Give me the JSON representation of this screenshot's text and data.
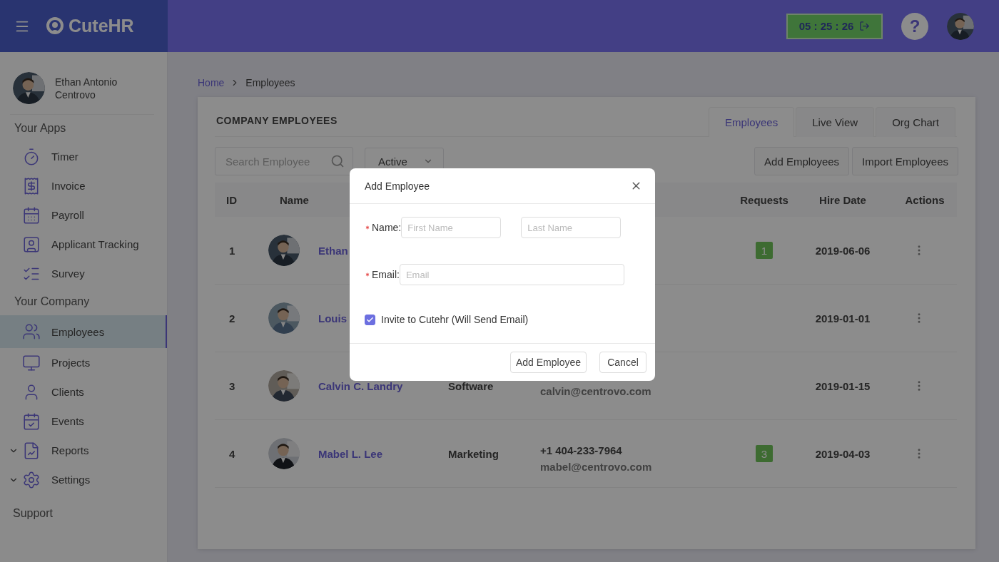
{
  "header": {
    "logo": "CuteHR",
    "timer": "05 : 25 : 26",
    "help_button": "?"
  },
  "sidebar": {
    "user_name": "Ethan Antonio Centrovo",
    "sections": [
      {
        "title": "Your Apps",
        "items": [
          {
            "label": "Timer",
            "selected": false,
            "expandable": false
          },
          {
            "label": "Invoice",
            "selected": false,
            "expandable": false
          },
          {
            "label": "Payroll",
            "selected": false,
            "expandable": false
          },
          {
            "label": "Applicant Tracking",
            "selected": false,
            "expandable": false
          },
          {
            "label": "Survey",
            "selected": false,
            "expandable": false
          }
        ]
      },
      {
        "title": "Your Company",
        "items": [
          {
            "label": "Employees",
            "selected": true,
            "expandable": false
          },
          {
            "label": "Projects",
            "selected": false,
            "expandable": false
          },
          {
            "label": "Clients",
            "selected": false,
            "expandable": false
          },
          {
            "label": "Events",
            "selected": false,
            "expandable": false
          },
          {
            "label": "Reports",
            "selected": false,
            "expandable": true
          },
          {
            "label": "Settings",
            "selected": false,
            "expandable": true
          }
        ]
      }
    ],
    "footer": "Support"
  },
  "breadcrumb": [
    {
      "label": "Home",
      "kind": "link"
    },
    {
      "label": "Employees",
      "kind": "current"
    }
  ],
  "card": {
    "title": "COMPANY EMPLOYEES",
    "tabs": [
      {
        "label": "Employees",
        "selected": true
      },
      {
        "label": "Live View",
        "selected": false
      },
      {
        "label": "Org Chart",
        "selected": false
      }
    ],
    "search": {
      "placeholder": "Search Employee"
    },
    "filter": "Active",
    "buttons": [
      "Add Employees",
      "Import Employees"
    ],
    "table": {
      "columns": {
        "id": "ID",
        "name": "Name",
        "requests": "Requests",
        "hire_date": "Hire Date",
        "actions": "Actions"
      },
      "rows": [
        {
          "id": "1",
          "name": "Ethan",
          "requests": "1",
          "hire_date": "2019-06-06"
        },
        {
          "id": "2",
          "name": "Louis",
          "hire_date": "2019-01-01"
        },
        {
          "id": "3",
          "name": "Calvin C. Landry",
          "department": "Software",
          "email": "calvin@centrovo.com",
          "hire_date": "2019-01-15"
        },
        {
          "id": "4",
          "name": "Mabel L. Lee",
          "department": "Marketing",
          "phone": "+1 404-233-7964",
          "email": "mabel@centrovo.com",
          "requests": "3",
          "hire_date": "2019-04-03"
        }
      ]
    }
  },
  "modal": {
    "title": "Add Employee",
    "name_field": {
      "label": "Name:",
      "required": true,
      "first_placeholder": "First Name",
      "last_placeholder": "Last Name"
    },
    "email_field": {
      "label": "Email:",
      "required": true,
      "placeholder": "Email"
    },
    "invite": {
      "label": "Invite to Cutehr (Will Send Email)",
      "checked": true
    },
    "buttons": [
      "Add Employee",
      "Cancel"
    ]
  }
}
